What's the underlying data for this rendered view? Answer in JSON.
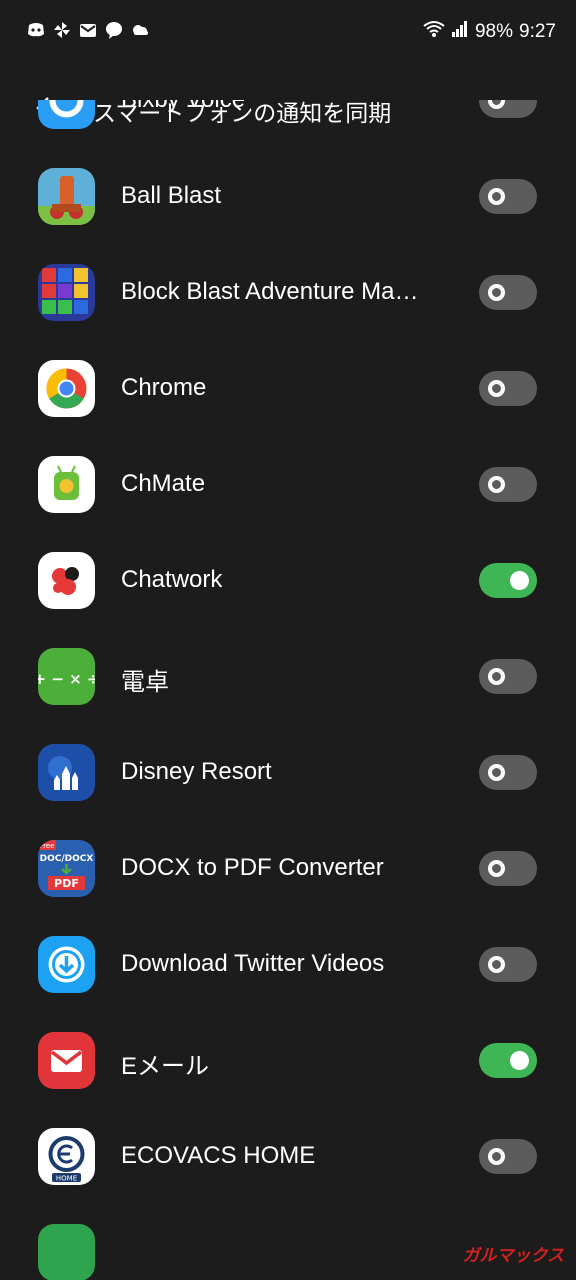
{
  "status_bar": {
    "battery": "98%",
    "time": "9:27",
    "icons": [
      "discord-icon",
      "pinwheel-icon",
      "mail-icon",
      "chat-icon",
      "cloud-icon",
      "wifi-icon",
      "signal-icon"
    ]
  },
  "header": {
    "title": "スマートフォンの通知を同期",
    "back_icon": "arrow-left-icon"
  },
  "apps": [
    {
      "label": "Bixby Voice",
      "enabled": false,
      "icon": "bixby-icon"
    },
    {
      "label": "Ball Blast",
      "enabled": false,
      "icon": "ball-blast-icon"
    },
    {
      "label": "Block Blast Adventure Ma…",
      "enabled": false,
      "icon": "block-blast-icon"
    },
    {
      "label": "Chrome",
      "enabled": false,
      "icon": "chrome-icon"
    },
    {
      "label": "ChMate",
      "enabled": false,
      "icon": "chmate-icon"
    },
    {
      "label": "Chatwork",
      "enabled": true,
      "icon": "chatwork-icon"
    },
    {
      "label": "電卓",
      "enabled": false,
      "icon": "calculator-icon"
    },
    {
      "label": "Disney Resort",
      "enabled": false,
      "icon": "disney-resort-icon"
    },
    {
      "label": "DOCX to PDF Converter",
      "enabled": false,
      "icon": "docx-pdf-icon"
    },
    {
      "label": "Download Twitter Videos",
      "enabled": false,
      "icon": "download-icon"
    },
    {
      "label": "Eメール",
      "enabled": true,
      "icon": "email-icon"
    },
    {
      "label": "ECOVACS HOME",
      "enabled": false,
      "icon": "ecovacs-icon"
    }
  ],
  "icon_text": {
    "docx_free": "Free",
    "docx_top": "DOC/DOCX",
    "docx_pdf": "PDF",
    "ecovacs_home": "HOME",
    "calc_symbols": "+ − × ÷"
  },
  "watermark": "ガルマックス",
  "colors": {
    "background": "#1c1c1c",
    "toggle_on": "#3fb655",
    "toggle_off": "#5c5c5c"
  }
}
